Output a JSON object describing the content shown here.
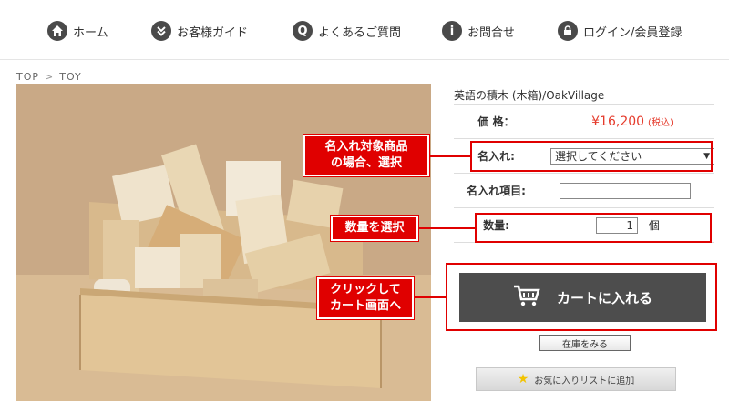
{
  "nav": {
    "home": "ホーム",
    "guide": "お客様ガイド",
    "faq": "よくあるご質問",
    "contact": "お問合せ",
    "login": "ログイン/会員登録",
    "faq_icon": "Q",
    "contact_icon": "i"
  },
  "breadcrumb": [
    "TOP",
    ">",
    "TOY"
  ],
  "product": {
    "title": "英語の積木 (木箱)/OakVillage",
    "rows": {
      "price_label": "価 格：",
      "price": "¥16,200",
      "price_tax": "(税込)",
      "engrave_label": "名入れ:",
      "engrave_select": "選択してください",
      "engrave_item_label": "名入れ項目:",
      "qty_label": "数量:",
      "qty_value": "1",
      "qty_unit": "個"
    },
    "cart_button": "カートに入れる",
    "stock_button": "在庫をみる",
    "fav_button": "お気に入りリストに追加"
  },
  "annotations": {
    "engrave": [
      "名入れ対象商品",
      "の場合、選択"
    ],
    "qty": "数量を選択",
    "cart": [
      "クリックして",
      "カート画面へ"
    ]
  },
  "colors": {
    "accent_red": "#e00000",
    "price_red": "#e53b2c",
    "button_dark": "#4d4d4d"
  }
}
